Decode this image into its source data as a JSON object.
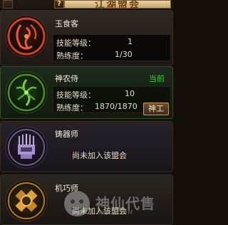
{
  "window": {
    "title": "江湖盟会",
    "help_label": "?"
  },
  "guilds": [
    {
      "name": "玉食客",
      "skill_level_label": "技能等级：",
      "skill_level": "1",
      "proficiency_label": "熟练度：",
      "proficiency": "1/30"
    },
    {
      "name": "神农侍",
      "current_label": "当前",
      "skill_level_label": "技能等级：",
      "skill_level": "10",
      "proficiency_label": "熟练度：",
      "proficiency": "1870/1870",
      "action_label": "神工"
    },
    {
      "name": "铸器师",
      "status": "尚未加入该盟会"
    },
    {
      "name": "机巧师",
      "status": "尚未加入该盟会"
    }
  ],
  "watermark": {
    "text": "神仙代售",
    "sub": "SXDS.COM"
  },
  "colors": {
    "current": "#31d633",
    "title_bg": "#d9bd85",
    "emblem_red": "#c8452c",
    "emblem_green": "#5fb83a",
    "emblem_purple": "#8f7ab8",
    "emblem_gold": "#d4952f"
  }
}
